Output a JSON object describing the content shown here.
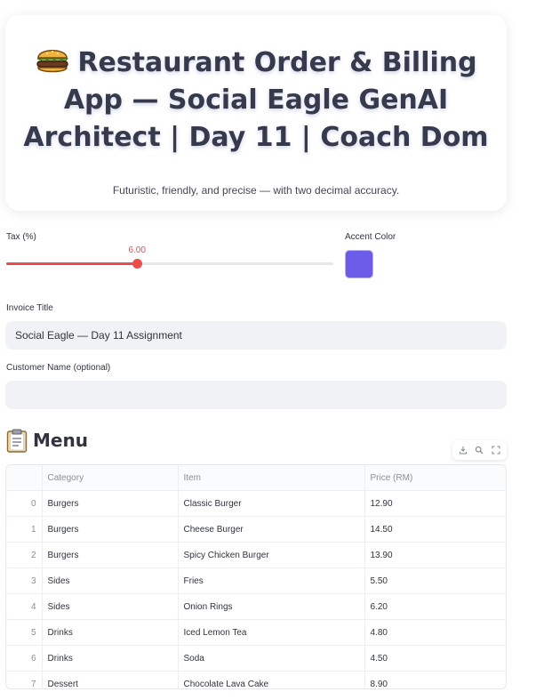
{
  "header": {
    "title": "Restaurant Order & Billing App — Social Eagle GenAI Architect | Day 11 | Coach Dom",
    "subtitle": "Futuristic, friendly, and precise — with two decimal accuracy.",
    "icon": "burger-icon"
  },
  "controls": {
    "tax": {
      "label": "Tax (%)",
      "value": "6.00",
      "fill_fraction": 0.4
    },
    "accent": {
      "label": "Accent Color",
      "color": "#6c5ce7"
    },
    "invoice_title": {
      "label": "Invoice Title",
      "value": "Social Eagle — Day 11 Assignment"
    },
    "customer_name": {
      "label": "Customer Name (optional)",
      "value": ""
    }
  },
  "menu": {
    "heading": "Menu",
    "icon": "clipboard-icon",
    "toolbar": [
      "download-icon",
      "search-icon",
      "fullscreen-icon"
    ],
    "columns": [
      "",
      "Category",
      "Item",
      "Price (RM)"
    ],
    "rows": [
      {
        "index": "0",
        "category": "Burgers",
        "item": "Classic Burger",
        "price": "12.90"
      },
      {
        "index": "1",
        "category": "Burgers",
        "item": "Cheese Burger",
        "price": "14.50"
      },
      {
        "index": "2",
        "category": "Burgers",
        "item": "Spicy Chicken Burger",
        "price": "13.90"
      },
      {
        "index": "3",
        "category": "Sides",
        "item": "Fries",
        "price": "5.50"
      },
      {
        "index": "4",
        "category": "Sides",
        "item": "Onion Rings",
        "price": "6.20"
      },
      {
        "index": "5",
        "category": "Drinks",
        "item": "Iced Lemon Tea",
        "price": "4.80"
      },
      {
        "index": "6",
        "category": "Drinks",
        "item": "Soda",
        "price": "4.50"
      },
      {
        "index": "7",
        "category": "Dessert",
        "item": "Chocolate Lava Cake",
        "price": "8.90"
      }
    ]
  },
  "colors": {
    "slider": "#ee4b4b",
    "title": "#373a4c"
  }
}
